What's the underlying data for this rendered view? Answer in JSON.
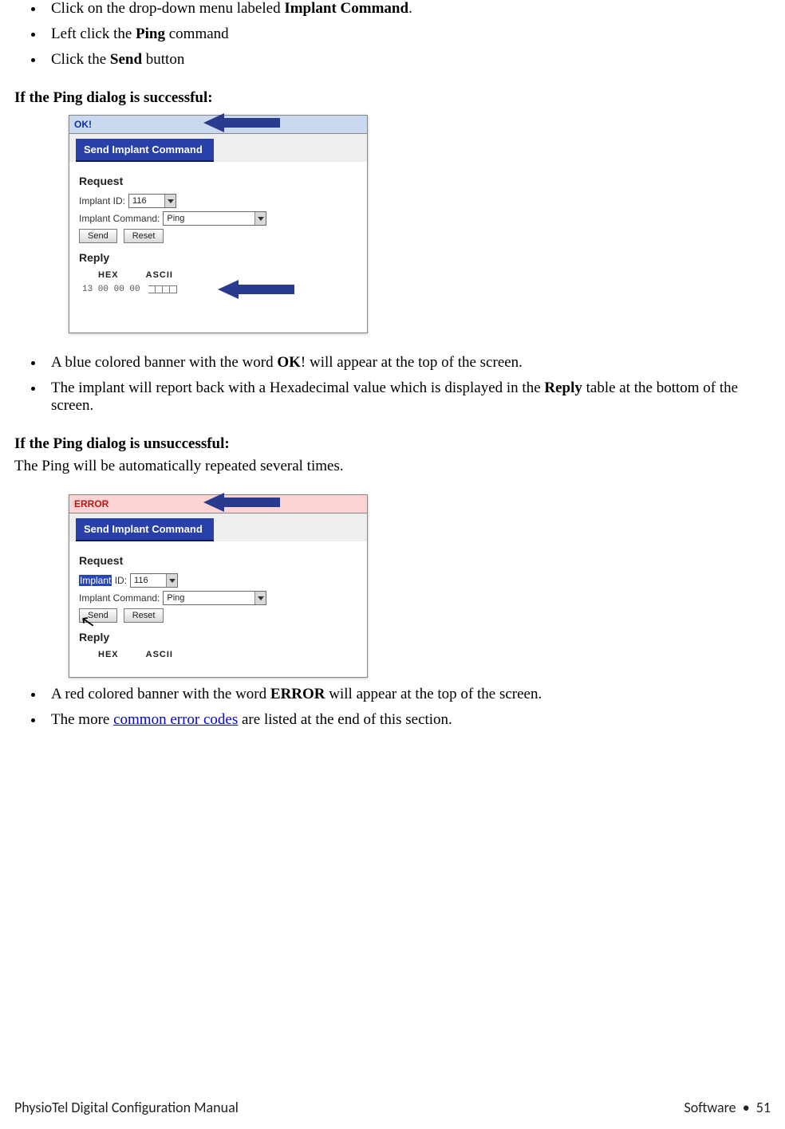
{
  "bullets_top": [
    {
      "pre": "Click on the drop-down menu labeled ",
      "bold": "Implant Command",
      "post": "."
    },
    {
      "pre": "Left click the ",
      "bold": "Ping",
      "post": " command"
    },
    {
      "pre": "Click the ",
      "bold": "Send",
      "post": " button"
    }
  ],
  "success": {
    "heading": "If the Ping dialog is successful:",
    "banner": "OK!",
    "tab": "Send Implant Command",
    "request": "Request",
    "implant_id_label": "Implant ID:",
    "implant_id_value": "116",
    "implant_cmd_label": "Implant Command:",
    "implant_cmd_value": "Ping",
    "send": "Send",
    "reset": "Reset",
    "reply": "Reply",
    "col_hex": "HEX",
    "col_ascii": "ASCII",
    "hex_value": "13 00 00 00",
    "bullets": [
      {
        "pre": "A blue colored banner with the word ",
        "bold": "OK",
        "post": "! will appear at the top of the screen."
      },
      {
        "pre": "The implant will report back with a Hexadecimal value which is displayed in the ",
        "bold": "Reply",
        "post": " table at the bottom of the screen."
      }
    ]
  },
  "fail": {
    "heading": "If the Ping dialog is unsuccessful:",
    "intro": "The Ping will be automatically repeated several times.",
    "banner": "ERROR",
    "tab": "Send Implant Command",
    "request": "Request",
    "implant_id_label_hi": "Implant",
    "implant_id_label_rest": " ID:",
    "implant_id_value": "116",
    "implant_cmd_label": "Implant Command:",
    "implant_cmd_value": "Ping",
    "send": "Send",
    "reset": "Reset",
    "reply": "Reply",
    "col_hex": "HEX",
    "col_ascii": "ASCII",
    "bullets": [
      {
        "pre": " A red colored banner with the word ",
        "bold": "ERROR",
        "post": " will appear at the top of the screen."
      },
      {
        "pre": "The more ",
        "link": "common error codes",
        "post": " are listed at the end of this section."
      }
    ]
  },
  "footer": {
    "left": "PhysioTel Digital Configuration Manual",
    "right_label": "Software",
    "page": "51"
  }
}
